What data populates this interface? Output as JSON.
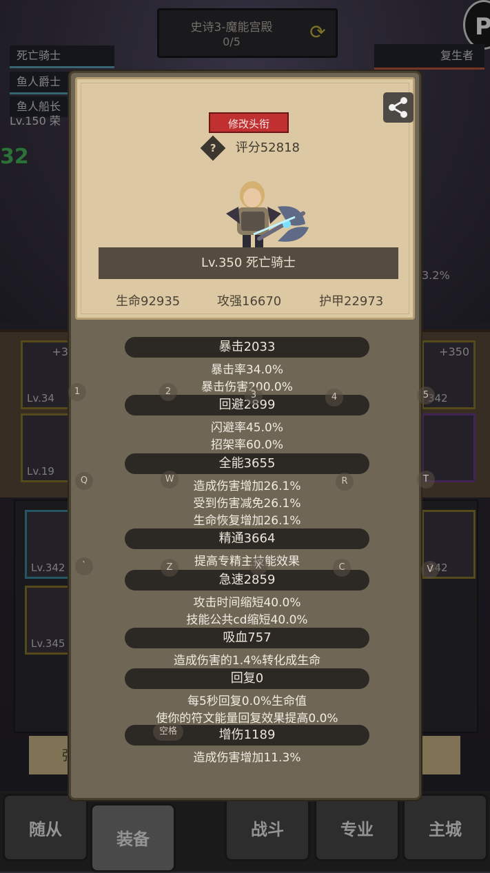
{
  "background": {
    "dungeon": {
      "title": "史诗3-魔能宫殿",
      "progress": "0/5"
    },
    "party": [
      "死亡骑士",
      "鱼人爵士",
      "鱼人船长"
    ],
    "party_level_text": "Lv.150 荣",
    "enemy": "复生者",
    "right_percent": "3.2%",
    "big_number": "32",
    "slots": [
      {
        "level": "Lv.34",
        "plus": "+3"
      },
      {
        "level": "Lv.19",
        "plus": ""
      },
      {
        "level": "Lv.342",
        "plus": ""
      },
      {
        "level": "Lv.345",
        "plus": ""
      },
      {
        "level": "342",
        "plus": "+350"
      },
      {
        "level": "342",
        "plus": ""
      }
    ],
    "bottom_bar_left": "强",
    "nav": [
      "随从",
      "装备",
      "战斗",
      "专业",
      "主城"
    ]
  },
  "panel": {
    "title_button": "修改头衔",
    "score_icon": "?",
    "score": "评分52818",
    "hero_name": "Lv.350 死亡骑士",
    "basic_stats": {
      "hp": "生命92935",
      "attack": "攻强16670",
      "armor": "护甲22973"
    },
    "stats": [
      {
        "head": "暴击2033",
        "lines": [
          "暴击率34.0%",
          "暴击伤害200.0%"
        ]
      },
      {
        "head": "回避2899",
        "lines": [
          "闪避率45.0%",
          "招架率60.0%"
        ]
      },
      {
        "head": "全能3655",
        "lines": [
          "造成伤害增加26.1%",
          "受到伤害减免26.1%",
          "生命恢复增加26.1%"
        ]
      },
      {
        "head": "精通3664",
        "lines": [
          "提高专精主技能效果"
        ]
      },
      {
        "head": "急速2859",
        "lines": [
          "攻击时间缩短40.0%",
          "技能公共cd缩短40.0%"
        ]
      },
      {
        "head": "吸血757",
        "lines": [
          "造成伤害的1.4%转化成生命"
        ]
      },
      {
        "head": "回复0",
        "lines": [
          "每5秒回复0.0%生命值",
          "使你的符文能量回复效果提高0.0%"
        ]
      },
      {
        "head": "增伤1189",
        "lines": [
          "造成伤害增加11.3%"
        ]
      }
    ]
  },
  "key_hints": {
    "k1": "1",
    "k2": "2",
    "k3": "3",
    "k4": "4",
    "k5": "5",
    "kq": "Q",
    "kw": "W",
    "kr": "R",
    "kt": "T",
    "kbt": "`",
    "kz": "Z",
    "kx": "X",
    "kc": "C",
    "kv": "V",
    "kspace": "空格"
  }
}
